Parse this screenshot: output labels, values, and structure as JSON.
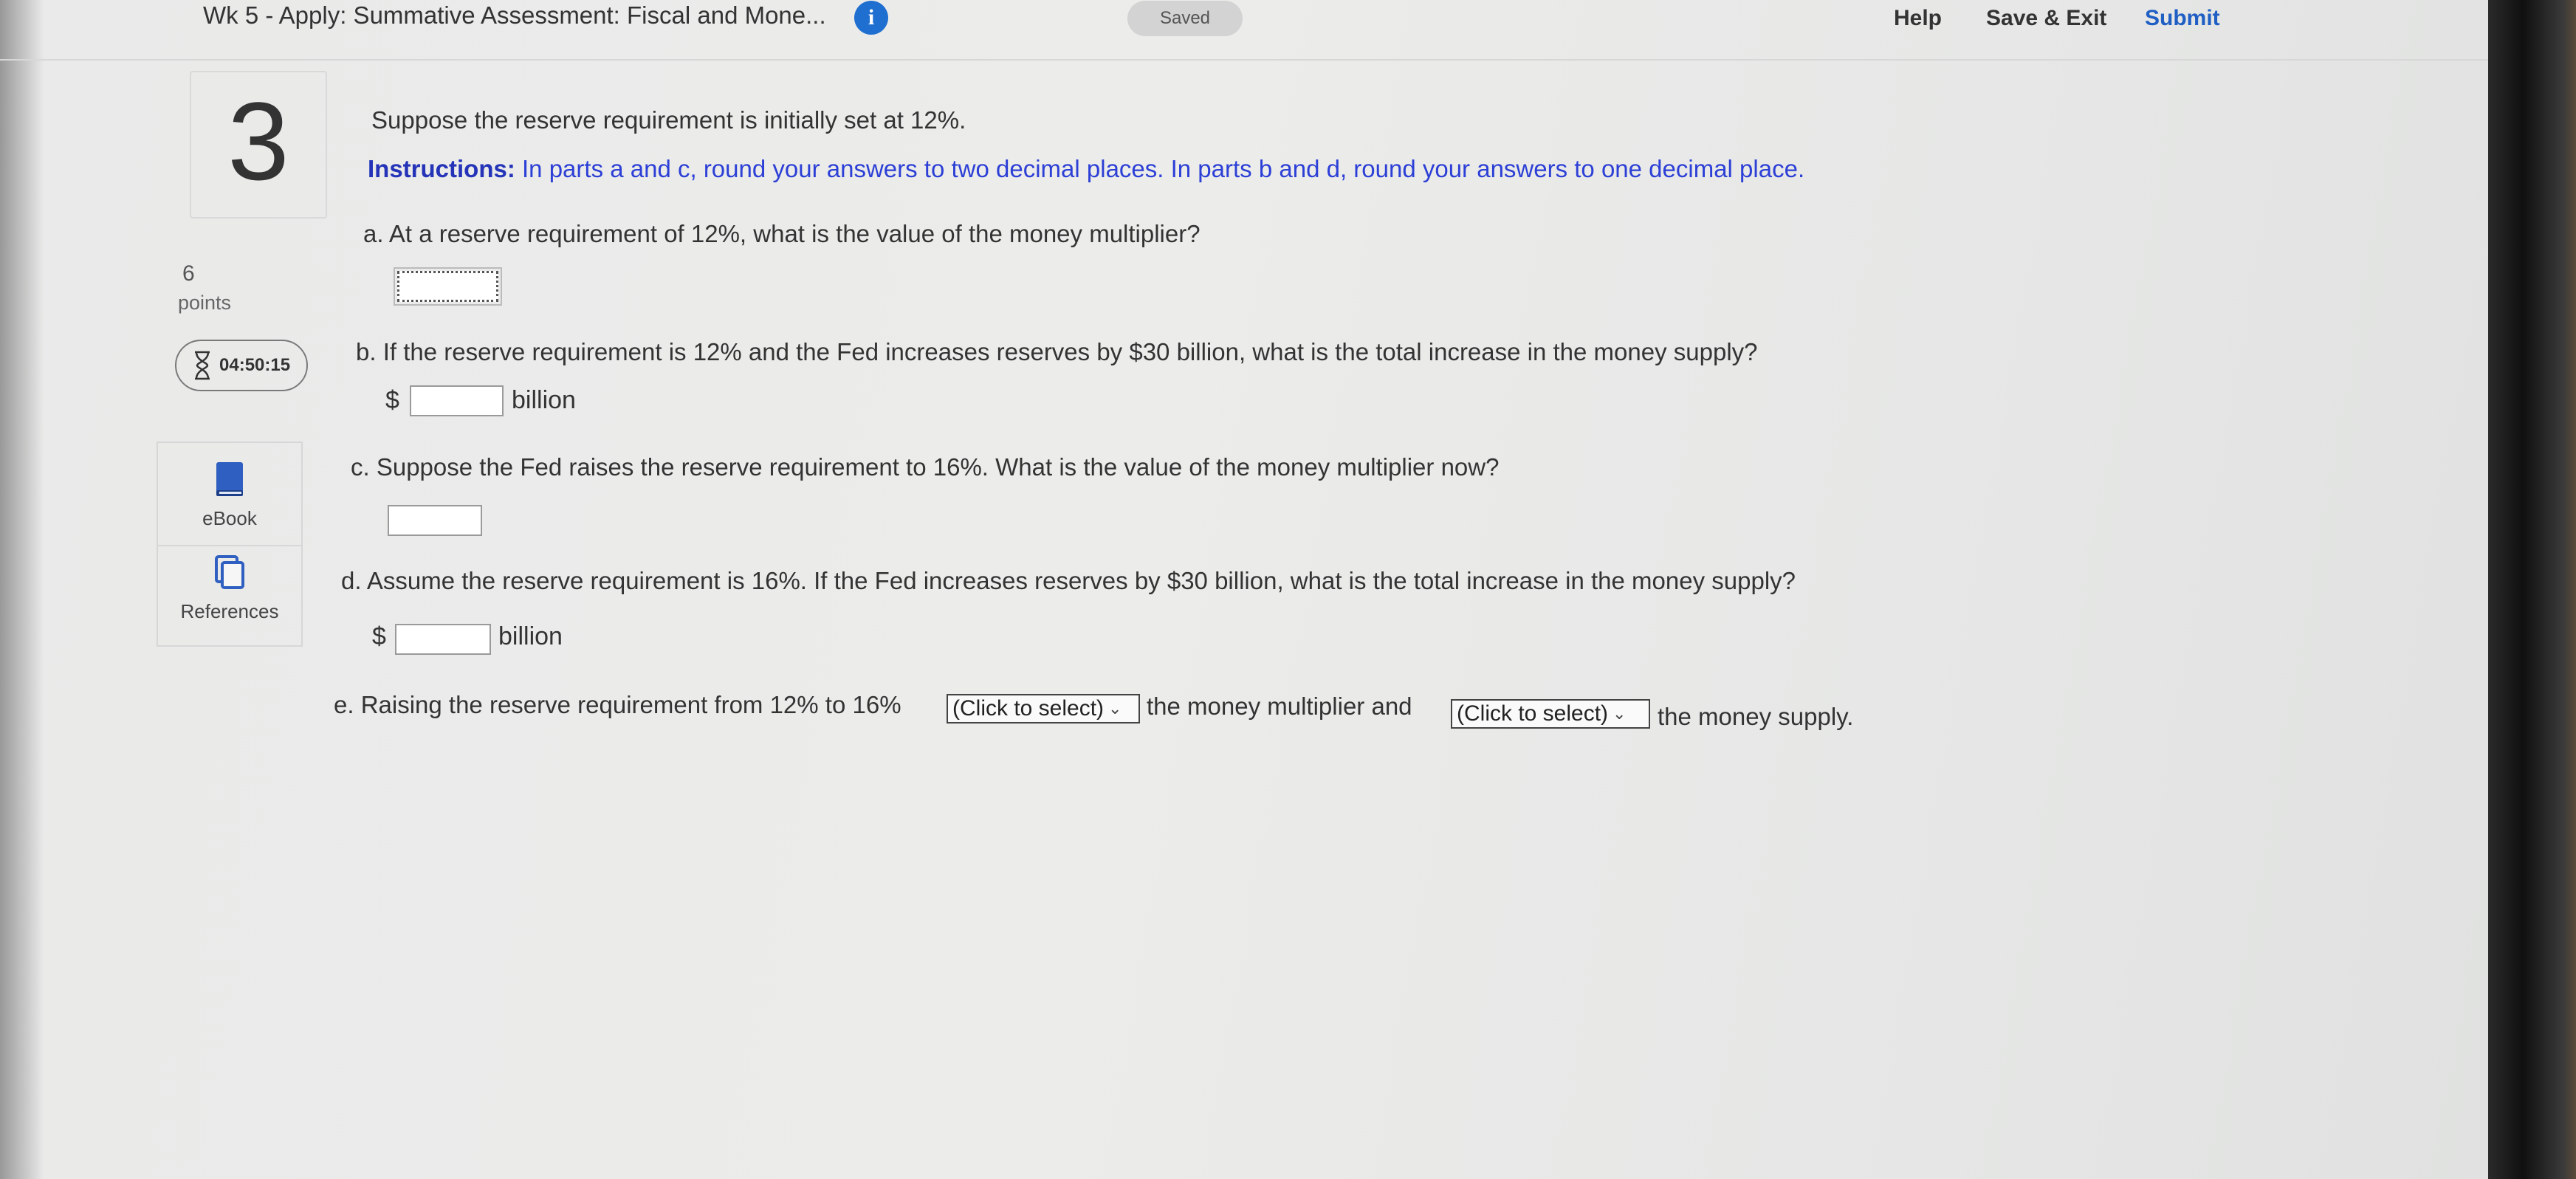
{
  "header": {
    "assignment_title": "Wk 5 - Apply: Summative Assessment: Fiscal and Mone...",
    "info_icon": "info-icon",
    "saved_status": "Saved",
    "help_label": "Help",
    "save_exit_label": "Save & Exit",
    "submit_label": "Submit"
  },
  "sidebar": {
    "question_number": "3",
    "points_value": "6",
    "points_label": "points",
    "timer": "04:50:15",
    "timer_icon": "hourglass-icon",
    "ebook_label": "eBook",
    "ebook_icon": "book-icon",
    "references_label": "References",
    "references_icon": "copy-icon"
  },
  "question": {
    "intro": "Suppose the reserve requirement is initially set at 12%.",
    "instructions_label": "Instructions:",
    "instructions_text": " In parts a and c, round your answers to two decimal places. In parts b and d, round your answers to one decimal place.",
    "part_a": "a. At a reserve requirement of 12%, what is the value of the money multiplier?",
    "part_a_value": "",
    "part_b": "b. If the reserve requirement is 12% and the Fed increases reserves by $30 billion, what is the total increase in the money supply?",
    "part_b_prefix": "$",
    "part_b_value": "",
    "part_b_unit": "billion",
    "part_c": "c. Suppose the Fed raises the reserve requirement to 16%. What is the value of the money multiplier now?",
    "part_c_value": "",
    "part_d": "d. Assume the reserve requirement is 16%. If the Fed increases reserves by $30 billion, what is the total increase in the money supply?",
    "part_d_prefix": "$",
    "part_d_value": "",
    "part_d_unit": "billion",
    "part_e_prefix": "e. Raising the reserve requirement from 12% to 16%",
    "part_e_select1": "(Click to select)",
    "part_e_middle": "the money multiplier and",
    "part_e_select2": "(Click to select)",
    "part_e_suffix": "the money supply."
  }
}
